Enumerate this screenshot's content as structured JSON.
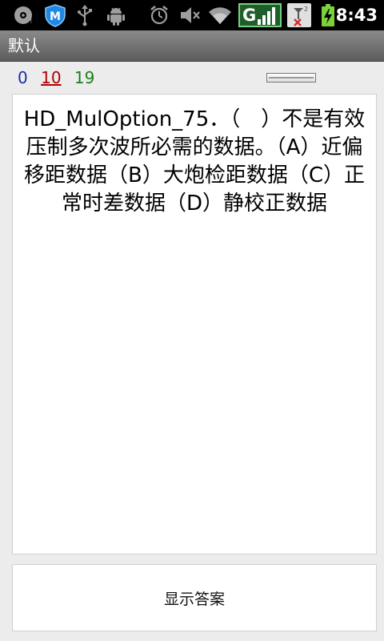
{
  "status_bar": {
    "time": "8:43",
    "network_label": "G",
    "icons": [
      "disc-icon",
      "shield-app-icon",
      "usb-icon",
      "android-debug-icon",
      "alarm-icon",
      "mute-icon",
      "wifi-icon",
      "signal-icon",
      "sim-missing-icon",
      "battery-charging-icon"
    ]
  },
  "title_bar": {
    "title": "默认"
  },
  "counters": {
    "zero": "0",
    "wrong": "10",
    "total": "19"
  },
  "question": {
    "text": "HD_MulOption_75．（　）不是有效压制多次波所必需的数据。（A）近偏移距数据（B）大炮检距数据（C）正常时差数据（D）静校正数据"
  },
  "answer_button": {
    "label": "显示答案"
  },
  "colors": {
    "zero": "#1b2fa3",
    "wrong": "#b00000",
    "total": "#1a7f1a",
    "network_green": "#2e7d32"
  }
}
